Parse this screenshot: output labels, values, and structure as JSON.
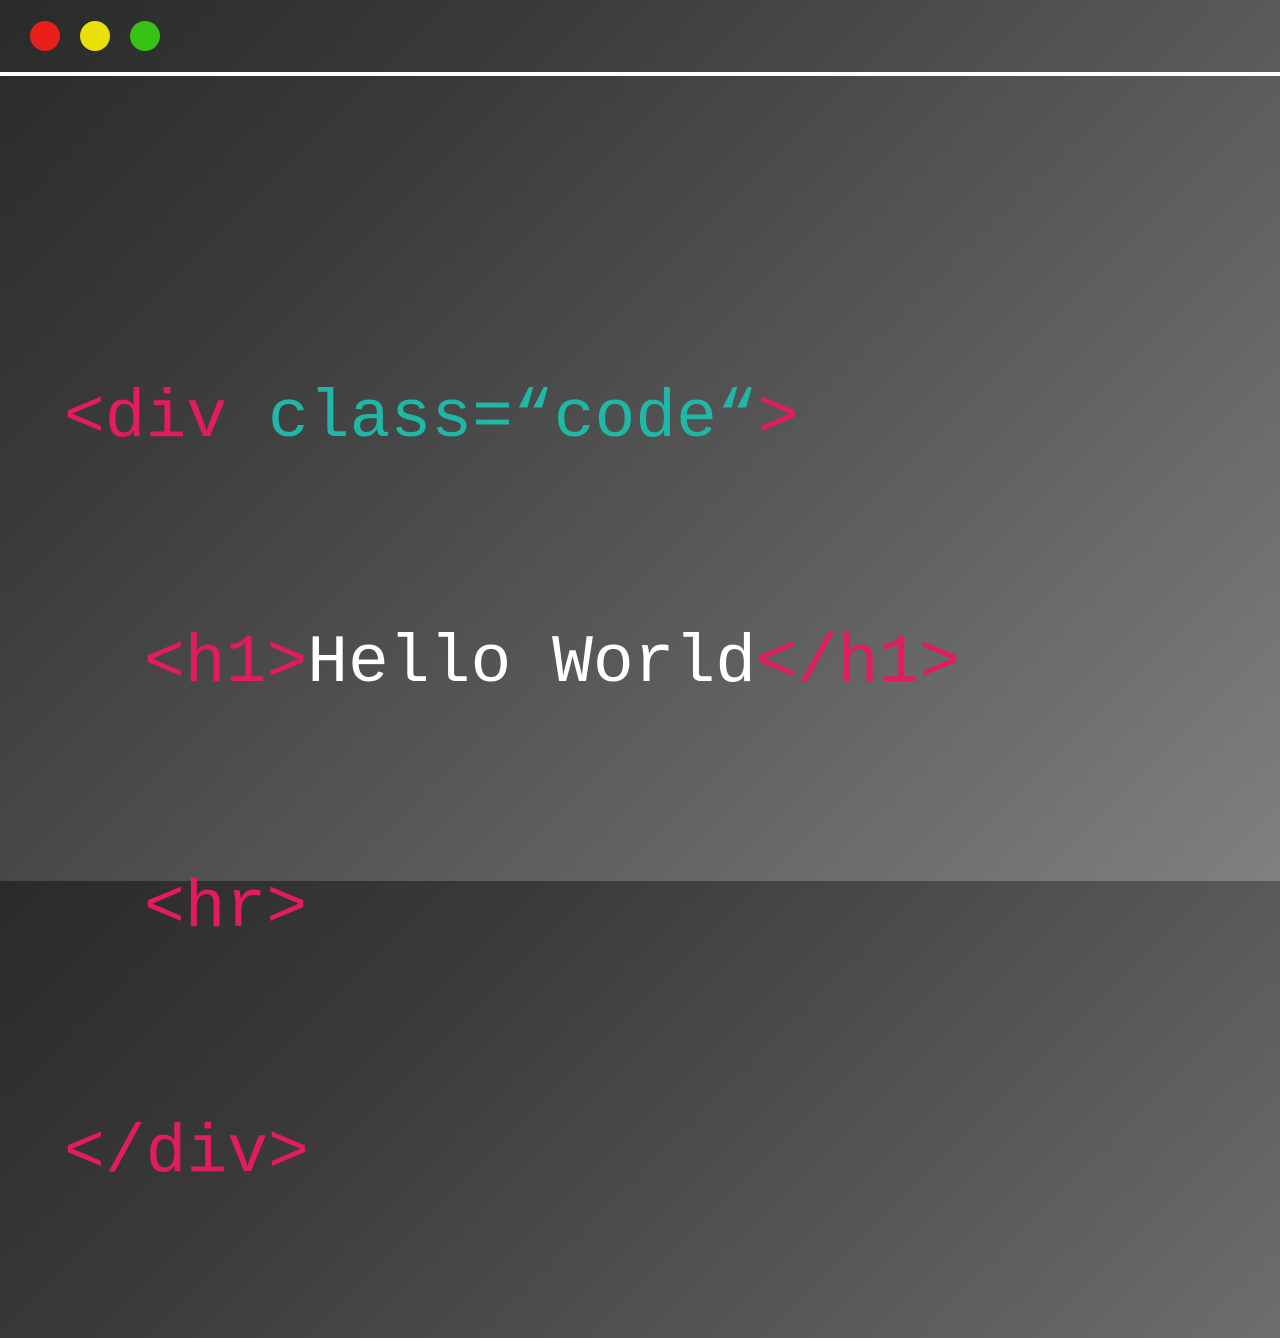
{
  "code": {
    "line1": {
      "open_tag": "<div",
      "space": " ",
      "attr": "class=“code“",
      "close_bracket": ">"
    },
    "line2": {
      "open_tag": "<h1>",
      "text": "Hello World",
      "close_tag": "</h1>"
    },
    "line3": {
      "tag": "<hr>"
    },
    "line4": {
      "close_tag": "</div>"
    }
  },
  "colors": {
    "tag": "#e31b5f",
    "attr": "#1fb8a6",
    "text": "#ffffff",
    "red": "#e7201a",
    "yellow": "#e8e108",
    "green": "#38c213"
  }
}
